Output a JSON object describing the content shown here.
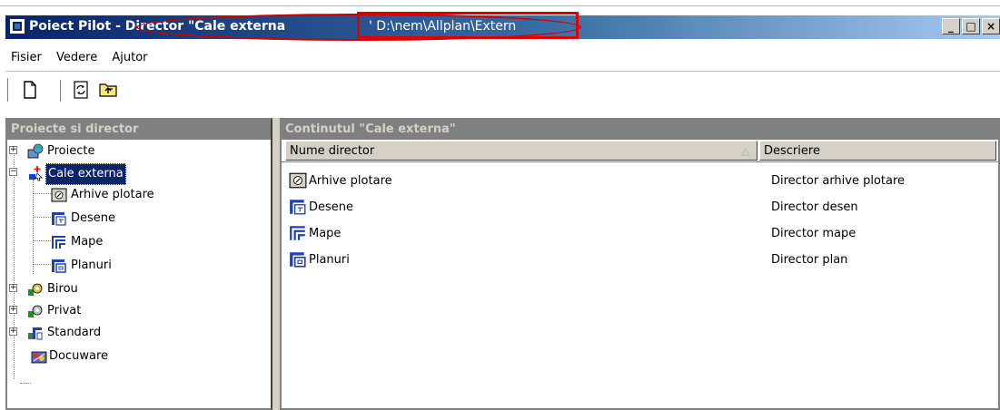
{
  "window": {
    "title": "Poiect Pilot - Director \"Cale externa",
    "title_path": "' D:\\nem\\Allplan\\Extern",
    "controls": {
      "minimize": "_",
      "maximize": "□",
      "close": "×"
    }
  },
  "menu": {
    "items": [
      "Fisier",
      "Vedere",
      "Ajutor"
    ]
  },
  "toolbar": {
    "icons": [
      "new-document-icon",
      "refresh-icon",
      "folder-up-icon"
    ]
  },
  "left_panel": {
    "header": "Proiecte si director",
    "tree": [
      {
        "label": "Proiecte",
        "icon": "projects-globe-icon",
        "level": 0,
        "expander": "+"
      },
      {
        "label": "Cale externa",
        "icon": "external-path-icon",
        "level": 0,
        "expander": "−",
        "selected": true
      },
      {
        "label": "Arhive plotare",
        "icon": "plot-archive-icon",
        "level": 1
      },
      {
        "label": "Desene",
        "icon": "drawing-folder-icon",
        "level": 1
      },
      {
        "label": "Mape",
        "icon": "map-folder-icon",
        "level": 1
      },
      {
        "label": "Planuri",
        "icon": "plan-folder-icon",
        "level": 1
      },
      {
        "label": "Birou",
        "icon": "office-icon",
        "level": 0,
        "expander": "+"
      },
      {
        "label": "Privat",
        "icon": "private-icon",
        "level": 0,
        "expander": "+"
      },
      {
        "label": "Standard",
        "icon": "standard-icon",
        "level": 0,
        "expander": "+"
      },
      {
        "label": "Docuware",
        "icon": "docuware-icon",
        "level": 0
      }
    ]
  },
  "right_panel": {
    "header": "Continutul \"Cale externa\"",
    "columns": [
      "Nume director",
      "Descriere"
    ],
    "sort_indicator": "△",
    "rows": [
      {
        "name": "Arhive plotare",
        "description": "Director arhive plotare",
        "icon": "plot-archive-icon"
      },
      {
        "name": "Desene",
        "description": "Director desen",
        "icon": "drawing-folder-icon"
      },
      {
        "name": "Mape",
        "description": "Director mape",
        "icon": "map-folder-icon"
      },
      {
        "name": "Planuri",
        "description": "Director plan",
        "icon": "plan-folder-icon"
      }
    ]
  },
  "colors": {
    "titlebar_start": "#0a246a",
    "titlebar_end": "#a6caf0",
    "panel_header_bg": "#808080",
    "panel_header_text": "#d4d0c8",
    "selection_bg": "#0a246a",
    "annotation_red": "#e00000"
  }
}
